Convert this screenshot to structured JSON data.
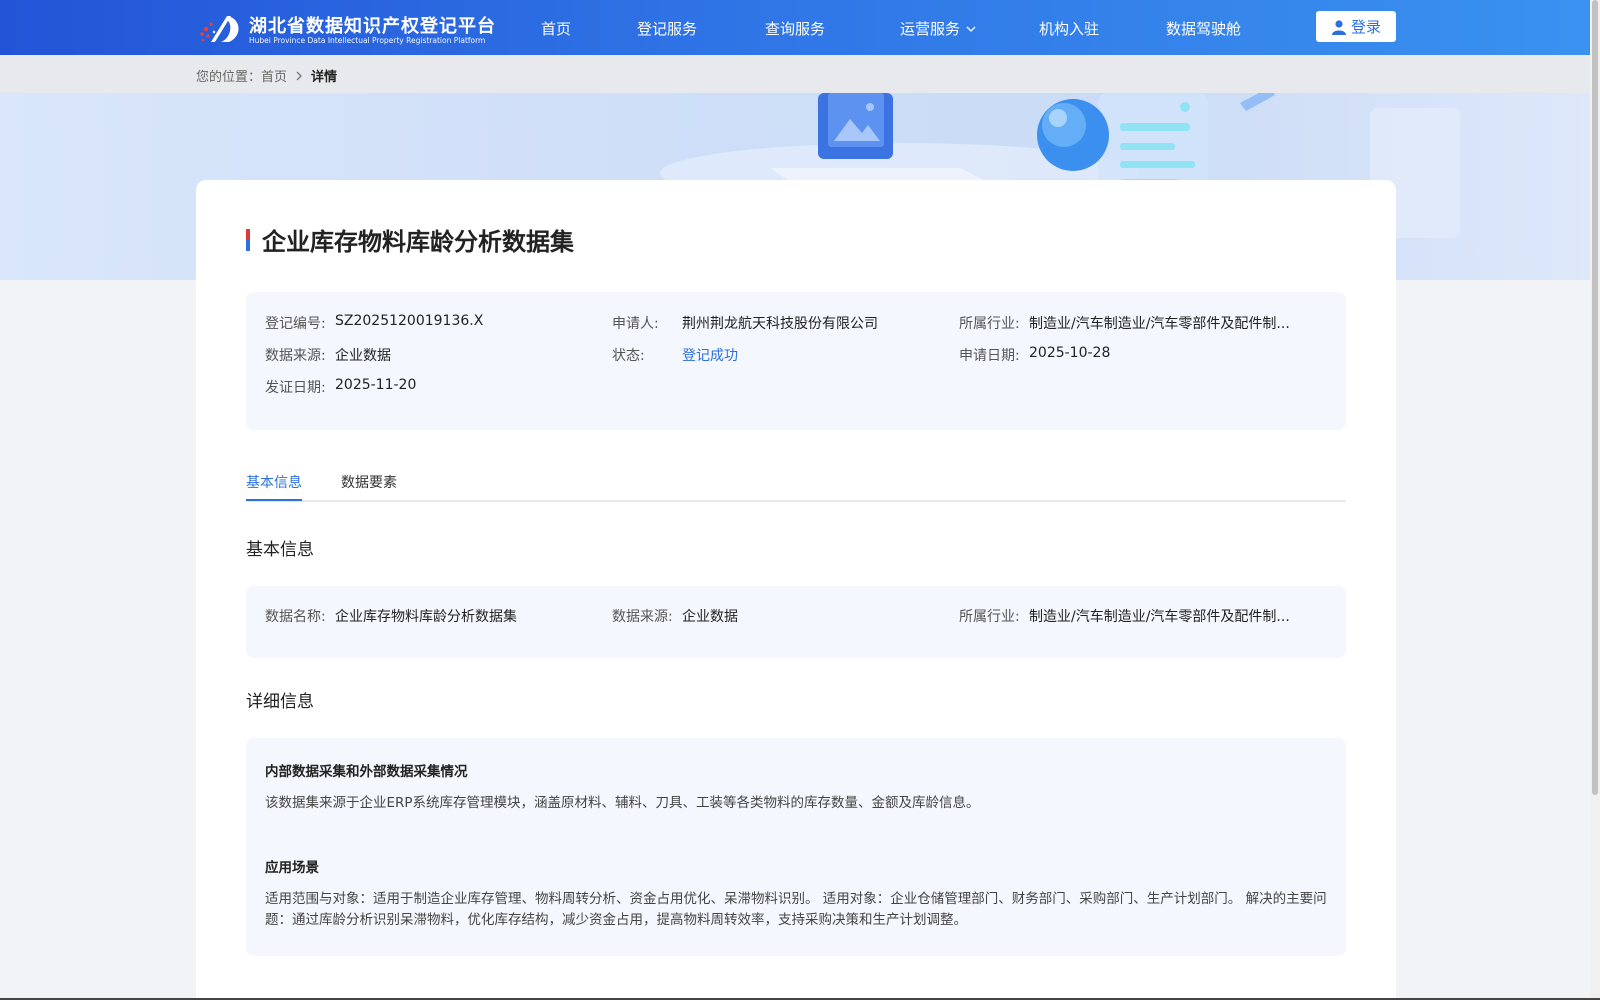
{
  "header": {
    "logo_cn": "湖北省数据知识产权登记平台",
    "logo_en": "Hubei Province Data Intellectual Property Registration Platform",
    "nav": [
      "首页",
      "登记服务",
      "查询服务",
      "运营服务",
      "机构入驻",
      "数据驾驶舱"
    ],
    "login_label": "登录"
  },
  "breadcrumb": {
    "prefix": "您的位置：",
    "home": "首页",
    "current": "详情"
  },
  "detail": {
    "title": "企业库存物料库龄分析数据集",
    "info": {
      "reg_no_label": "登记编号:",
      "reg_no": "SZ2025120019136.X",
      "applicant_label": "申请人:",
      "applicant": "荆州荆龙航天科技股份有限公司",
      "industry_label": "所属行业:",
      "industry": "制造业/汽车制造业/汽车零部件及配件制...",
      "source_label": "数据来源:",
      "source": "企业数据",
      "status_label": "状态:",
      "status": "登记成功",
      "apply_date_label": "申请日期:",
      "apply_date": "2025-10-28",
      "issue_date_label": "发证日期:",
      "issue_date": "2025-11-20"
    },
    "tabs": [
      "基本信息",
      "数据要素"
    ],
    "basic_section_title": "基本信息",
    "basic": {
      "name_label": "数据名称:",
      "name": "企业库存物料库龄分析数据集",
      "source_label": "数据来源:",
      "source": "企业数据",
      "industry_label": "所属行业:",
      "industry": "制造业/汽车制造业/汽车零部件及配件制..."
    },
    "detail_section_title": "详细信息",
    "collection_title": "内部数据采集和外部数据采集情况",
    "collection_text": "该数据集来源于企业ERP系统库存管理模块，涵盖原材料、辅料、刀具、工装等各类物料的库存数量、金额及库龄信息。",
    "scenario_title": "应用场景",
    "scenario_text": "适用范围与对象：适用于制造企业库存管理、物料周转分析、资金占用优化、呆滞物料识别。 适用对象：企业仓储管理部门、财务部门、采购部门、生产计划部门。 解决的主要问题：通过库龄分析识别呆滞物料，优化库存结构，减少资金占用，提高物料周转效率，支持采购决策和生产计划调整。"
  },
  "colors": {
    "header_start": "#2354d7",
    "header_end": "#3a92ef",
    "accent": "#2c6fe0",
    "panel": "#f4f7fd"
  }
}
